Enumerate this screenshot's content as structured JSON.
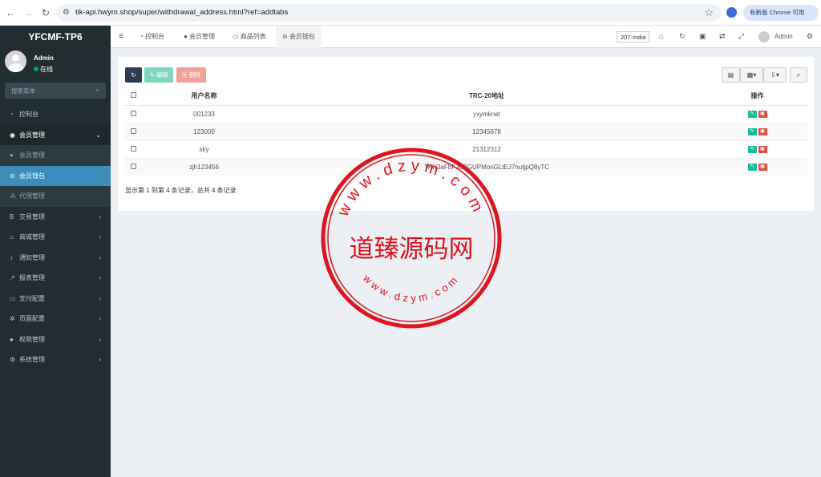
{
  "browser": {
    "url": "tik-api.hwym.shop/super/withdrawal_address.html?ref=addtabs",
    "update_label": "有新版 Chrome 可用"
  },
  "sidebar": {
    "logo": "YFCMF-TP6",
    "user_name": "Admin",
    "user_status": "在线",
    "search_placeholder": "搜索菜单",
    "items": [
      {
        "label": "控制台",
        "icon": "dashboard-icon"
      },
      {
        "label": "会员管理",
        "icon": "user-circle-icon"
      },
      {
        "label": "会员管理",
        "icon": "user-icon"
      },
      {
        "label": "会员钱包",
        "icon": "wallet-icon"
      },
      {
        "label": "代理管理",
        "icon": "sitemap-icon"
      },
      {
        "label": "交易管理",
        "icon": "bitcoin-icon"
      },
      {
        "label": "商城管理",
        "icon": "home-icon"
      },
      {
        "label": "通知管理",
        "icon": "bell-icon"
      },
      {
        "label": "报表管理",
        "icon": "chart-icon"
      },
      {
        "label": "支付配置",
        "icon": "card-icon"
      },
      {
        "label": "页面配置",
        "icon": "gear-icon"
      },
      {
        "label": "权限管理",
        "icon": "users-icon"
      },
      {
        "label": "系统管理",
        "icon": "cogs-icon"
      }
    ]
  },
  "topbar": {
    "tabs": [
      "控制台",
      "会员管理",
      "商品列表",
      "会员钱包"
    ],
    "country": "207-India",
    "admin": "Admin"
  },
  "toolbar": {
    "edit": "编辑",
    "delete": "删除"
  },
  "table": {
    "headers": [
      "用户名称",
      "TRC-20地址",
      "操作"
    ],
    "rows": [
      {
        "user": "001233",
        "address": "yxymknet"
      },
      {
        "user": "123000",
        "address": "12345678"
      },
      {
        "user": "sky",
        "address": "21312312"
      },
      {
        "user": "zjh123456",
        "address": "TKN3aFbFJG7GUPMonGLtEJ7nutjpQ8yTC"
      }
    ],
    "summary": "显示第 1 到第 4 条记录，总共 4 条记录"
  },
  "watermark": {
    "center": "道臻源码网",
    "top_ring": "www.dzym.com",
    "bottom_ring": "www.dzym.com"
  }
}
